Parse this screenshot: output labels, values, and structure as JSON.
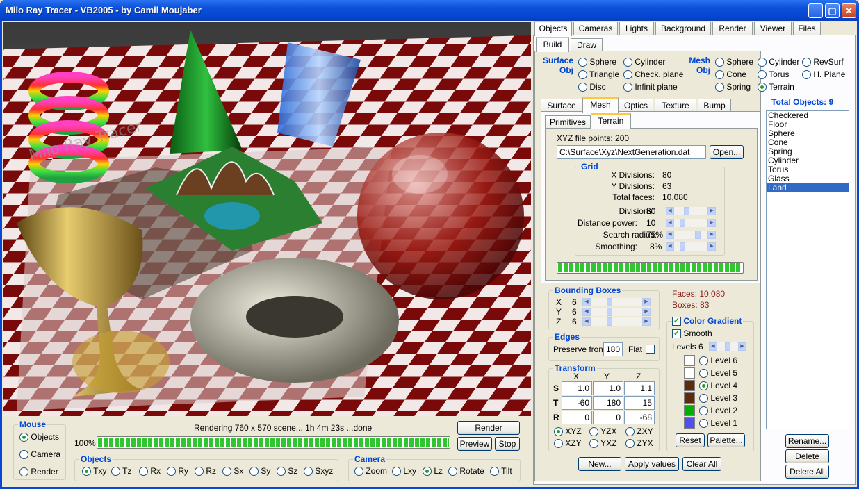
{
  "window": {
    "title": "Milo Ray Tracer - VB2005 - by Camil Moujaber"
  },
  "colors": {
    "accent": "#0046d5",
    "swatch_level6": "#ffffff",
    "swatch_level5": "#ffffff",
    "swatch_level4": "#5b2b0c",
    "swatch_level3": "#5b2b0c",
    "swatch_level2": "#00b000",
    "swatch_level1": "#5050f0"
  },
  "render": {
    "watermark": "Milo Ray Tracer"
  },
  "mouse": {
    "label": "Mouse",
    "options": [
      "Objects",
      "Camera",
      "Render"
    ],
    "selected": "Objects"
  },
  "status": {
    "text": "Rendering 760 x 570 scene... 1h 4m 23s ...done",
    "percent_label": "100%",
    "progress": 1.0
  },
  "buttons": {
    "render": "Render",
    "preview": "Preview",
    "stop": "Stop"
  },
  "objects_group": {
    "label": "Objects",
    "options": [
      "Txy",
      "Tz",
      "Rx",
      "Ry",
      "Rz",
      "Sx",
      "Sy",
      "Sz",
      "Sxyz"
    ],
    "selected": "Txy"
  },
  "camera_group": {
    "label": "Camera",
    "options": [
      "Zoom",
      "Lxy",
      "Lz",
      "Rotate",
      "Tilt"
    ],
    "selected": "Lz"
  },
  "main_tabs": [
    "Objects",
    "Cameras",
    "Lights",
    "Background",
    "Render",
    "Viewer",
    "Files"
  ],
  "sub_tabs": [
    "Build",
    "Draw"
  ],
  "surface_obj": {
    "label1": "Surface",
    "label2": "Obj",
    "options": [
      "Sphere",
      "Cylinder",
      "Triangle",
      "Check. plane",
      "Disc",
      "Infinit plane"
    ]
  },
  "mesh_obj": {
    "label1": "Mesh",
    "label2": "Obj",
    "options": [
      "Sphere",
      "Cylinder",
      "RevSurf",
      "Cone",
      "Torus",
      "H. Plane",
      "Spring",
      "Terrain"
    ],
    "selected": "Terrain"
  },
  "total_objects": "Total Objects: 9",
  "object_list": {
    "items": [
      "Checkered",
      "Floor",
      "Sphere",
      "Cone",
      "Spring",
      "Cylinder",
      "Torus",
      "Glass",
      "Land"
    ],
    "selected": "Land"
  },
  "prop_tabs": [
    "Surface",
    "Mesh",
    "Optics",
    "Texture",
    "Bump"
  ],
  "mesh_tabs": [
    "Primitives",
    "Terrain"
  ],
  "terrain": {
    "points_label": "XYZ file points: 200",
    "file_path": "C:\\Surface\\Xyz\\NextGeneration.dat",
    "open_button": "Open..."
  },
  "grid": {
    "label": "Grid",
    "x_div_label": "X Divisions:",
    "x_div": "80",
    "y_div_label": "Y Divisions:",
    "y_div": "63",
    "faces_label": "Total faces:",
    "faces": "10,080",
    "divisions_label": "Divisions:",
    "divisions": "80",
    "divisions_level": 0.35,
    "distance_label": "Distance power:",
    "distance": "10",
    "distance_level": 0.2,
    "search_label": "Search radius:",
    "search": "75%",
    "search_level": 0.75,
    "smoothing_label": "Smoothing:",
    "smoothing": "8%",
    "smoothing_level": 0.2
  },
  "terrain_progress": 1.0,
  "bounding": {
    "label": "Bounding Boxes",
    "x_label": "X",
    "x": "6",
    "y_label": "Y",
    "y": "6",
    "z_label": "Z",
    "z": "6",
    "level": 0.35
  },
  "faces_info": "Faces: 10,080",
  "boxes_info": "Boxes: 83",
  "edges": {
    "label": "Edges",
    "preserve_label": "Preserve from",
    "preserve": "180",
    "flat_label": "Flat"
  },
  "transform": {
    "label": "Transform",
    "col_x": "X",
    "col_y": "Y",
    "col_z": "Z",
    "row_s": "S",
    "row_t": "T",
    "row_r": "R",
    "s": [
      "1.0",
      "1.0",
      "1.1"
    ],
    "t": [
      "-60",
      "180",
      "15"
    ],
    "r": [
      "0",
      "0",
      "-68"
    ],
    "orders": [
      "XYZ",
      "YZX",
      "ZXY",
      "XZY",
      "YXZ",
      "ZYX"
    ],
    "selected_order": "XYZ"
  },
  "gradient": {
    "label": "Color Gradient",
    "smooth_label": "Smooth",
    "levels_label": "Levels",
    "levels": "6",
    "levels_level": 0.5,
    "level_names": [
      "Level 6",
      "Level 5",
      "Level 4",
      "Level 3",
      "Level 2",
      "Level 1"
    ],
    "selected_level": "Level 4",
    "reset": "Reset",
    "palette": "Palette..."
  },
  "bottom_buttons": {
    "new": "New...",
    "apply": "Apply values",
    "clear": "Clear All"
  },
  "list_buttons": {
    "rename": "Rename...",
    "delete": "Delete",
    "delete_all": "Delete All"
  }
}
